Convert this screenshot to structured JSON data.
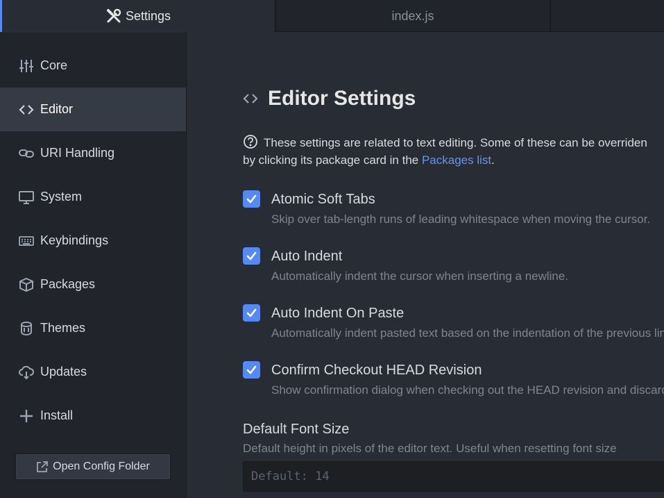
{
  "tabs": [
    {
      "label": "Settings",
      "icon": "tools-icon",
      "active": true
    },
    {
      "label": "index.js",
      "active": false
    }
  ],
  "sidebar": {
    "items": [
      {
        "label": "Core",
        "icon": "sliders-icon"
      },
      {
        "label": "Editor",
        "icon": "code-icon",
        "active": true
      },
      {
        "label": "URI Handling",
        "icon": "link-icon"
      },
      {
        "label": "System",
        "icon": "monitor-icon"
      },
      {
        "label": "Keybindings",
        "icon": "keyboard-icon"
      },
      {
        "label": "Packages",
        "icon": "package-icon"
      },
      {
        "label": "Themes",
        "icon": "paintcan-icon"
      },
      {
        "label": "Updates",
        "icon": "cloud-download-icon"
      },
      {
        "label": "Install",
        "icon": "plus-icon"
      }
    ],
    "open_config_label": "Open Config Folder"
  },
  "main": {
    "title": "Editor Settings",
    "description_prefix": "These settings are related to text editing. Some of these can be overriden",
    "description_line2": "by clicking its package card in the ",
    "packages_link": "Packages list",
    "description_suffix": ".",
    "settings": [
      {
        "label": "Atomic Soft Tabs",
        "hint": "Skip over tab-length runs of leading whitespace when moving the cursor.",
        "checked": true
      },
      {
        "label": "Auto Indent",
        "hint": "Automatically indent the cursor when inserting a newline.",
        "checked": true
      },
      {
        "label": "Auto Indent On Paste",
        "hint": "Automatically indent pasted text based on the indentation of the previous line.",
        "checked": true
      },
      {
        "label": "Confirm Checkout HEAD Revision",
        "hint": "Show confirmation dialog when checking out the HEAD revision and discarding changes.",
        "checked": true
      }
    ],
    "font_size": {
      "label": "Default Font Size",
      "hint": "Default height in pixels of the editor text. Useful when resetting font size",
      "placeholder": "Default: 14"
    }
  },
  "colors": {
    "accent": "#568af2",
    "background": "#282c34",
    "sidebar": "#21252b",
    "link": "#6494ed"
  }
}
